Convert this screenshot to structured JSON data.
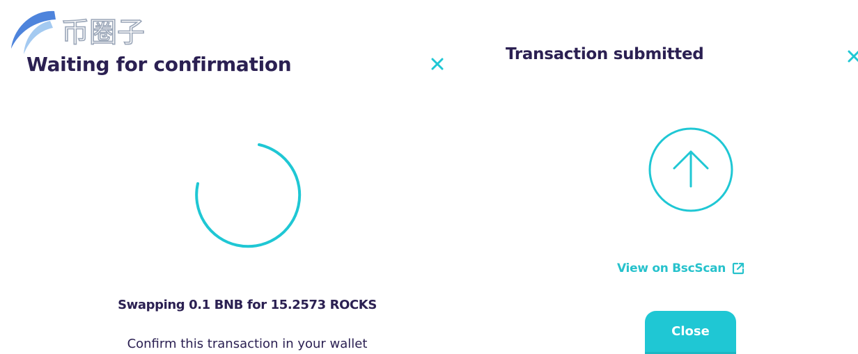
{
  "watermark": {
    "icon": "swoosh-logo-icon",
    "text": "币圈子",
    "colors": {
      "outer": "#2f6fd6",
      "inner": "#9ac4f0",
      "text": "#9aa6b8"
    }
  },
  "left_modal": {
    "title": "Waiting for confirmation",
    "close_icon": "close-icon",
    "spinner_icon": "loading-spinner-icon",
    "swap_summary": "Swapping 0.1 BNB for 15.2573 ROCKS",
    "instruction": "Confirm this transaction in your wallet"
  },
  "right_modal": {
    "title": "Transaction submitted",
    "close_icon": "close-icon",
    "status_icon": "arrow-up-circle-icon",
    "explorer_link": "View on BscScan",
    "explorer_link_icon": "external-link-icon",
    "close_button": "Close"
  },
  "colors": {
    "heading_text": "#2b2052",
    "accent": "#1fc7d4",
    "link": "#27c2cc",
    "button_text": "#ffffff"
  }
}
